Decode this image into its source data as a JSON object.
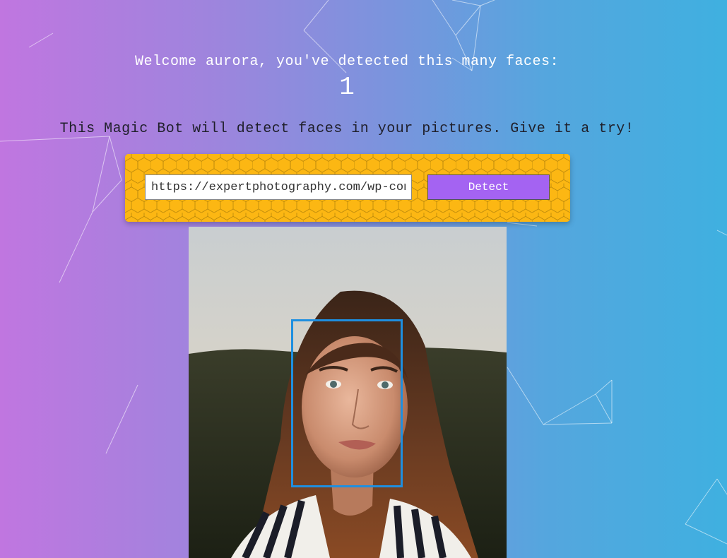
{
  "greeting": "Welcome aurora, you've detected this many faces:",
  "face_count": "1",
  "intro": "This Magic Bot will detect faces in your pictures. Give it a try!",
  "form": {
    "url_value": "https://expertphotography.com/wp-content",
    "detect_label": "Detect"
  },
  "colors": {
    "gradient_left": "#c076e0",
    "gradient_right": "#3fb0e0",
    "panel": "#fcb713",
    "button": "#a463f2",
    "face_box": "#1e8fe0"
  }
}
